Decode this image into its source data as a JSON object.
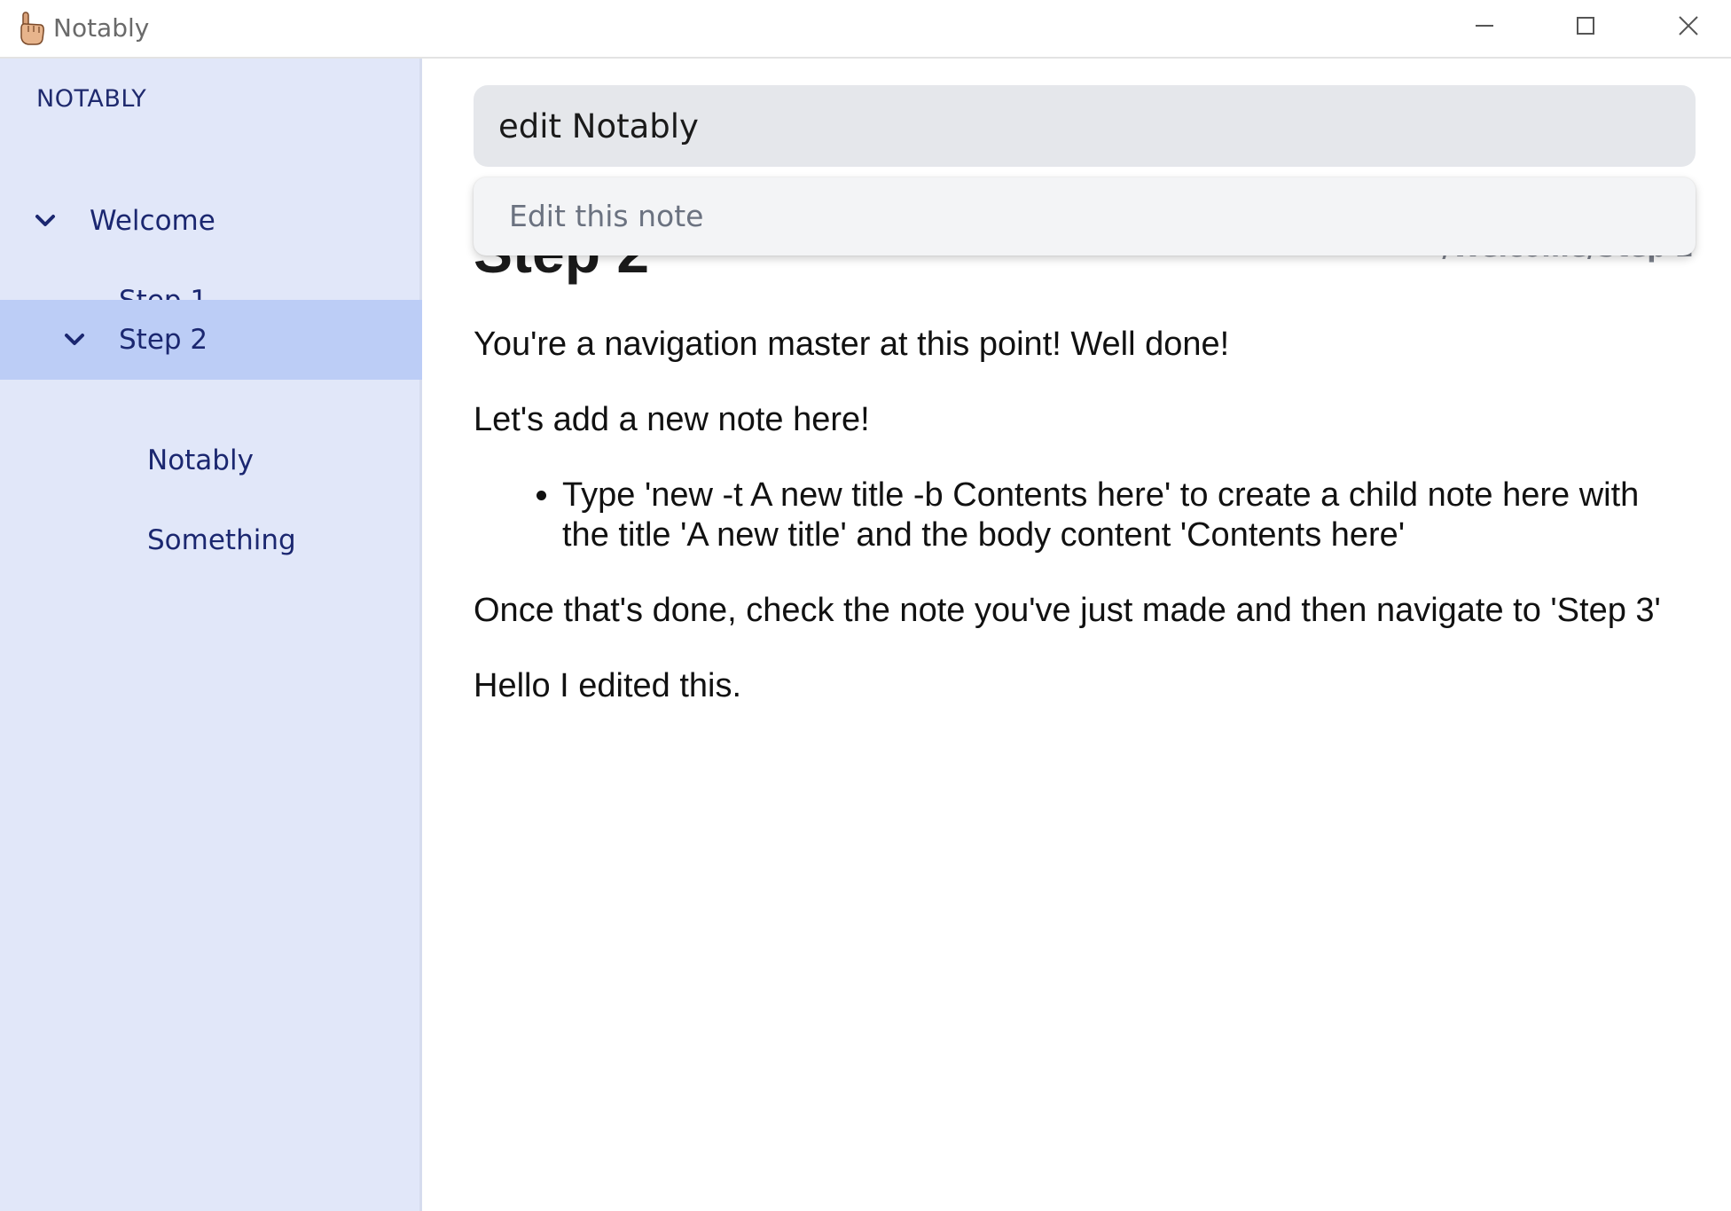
{
  "window": {
    "title": "Notably"
  },
  "sidebar": {
    "heading": "NOTABLY",
    "items": [
      {
        "label": "Welcome",
        "expanded": true,
        "selected": false
      },
      {
        "label": "Step 1",
        "expanded": false,
        "selected": false
      },
      {
        "label": "Step 2",
        "expanded": true,
        "selected": true
      },
      {
        "label": "Notably",
        "expanded": false,
        "selected": false
      },
      {
        "label": "Something",
        "expanded": false,
        "selected": false
      }
    ]
  },
  "command": {
    "value": "edit Notably",
    "suggestions": [
      "Edit this note"
    ]
  },
  "note": {
    "title": "Step 2",
    "breadcrumb": "/Welcome/Step 2",
    "paragraphs": [
      "You're a navigation master at this point! Well done!",
      "Let's add a new note here!"
    ],
    "bullets": [
      "Type 'new -t A new title -b Contents here' to create a child note here with the title 'A new title' and the body content 'Contents here'"
    ],
    "after_paragraphs": [
      "Once that's done, check the note you've just made and then navigate to 'Step 3'",
      "Hello I edited this."
    ]
  },
  "colors": {
    "sidebar_bg": "#e1e7f9",
    "sidebar_selected": "#bccdf6",
    "sidebar_text": "#1b2770",
    "command_input_bg": "#e5e7eb"
  },
  "icons": {
    "app": "pointing-hand-icon",
    "minimize": "minimize-icon",
    "maximize": "maximize-icon",
    "close": "close-icon",
    "chevron": "chevron-down-icon"
  }
}
